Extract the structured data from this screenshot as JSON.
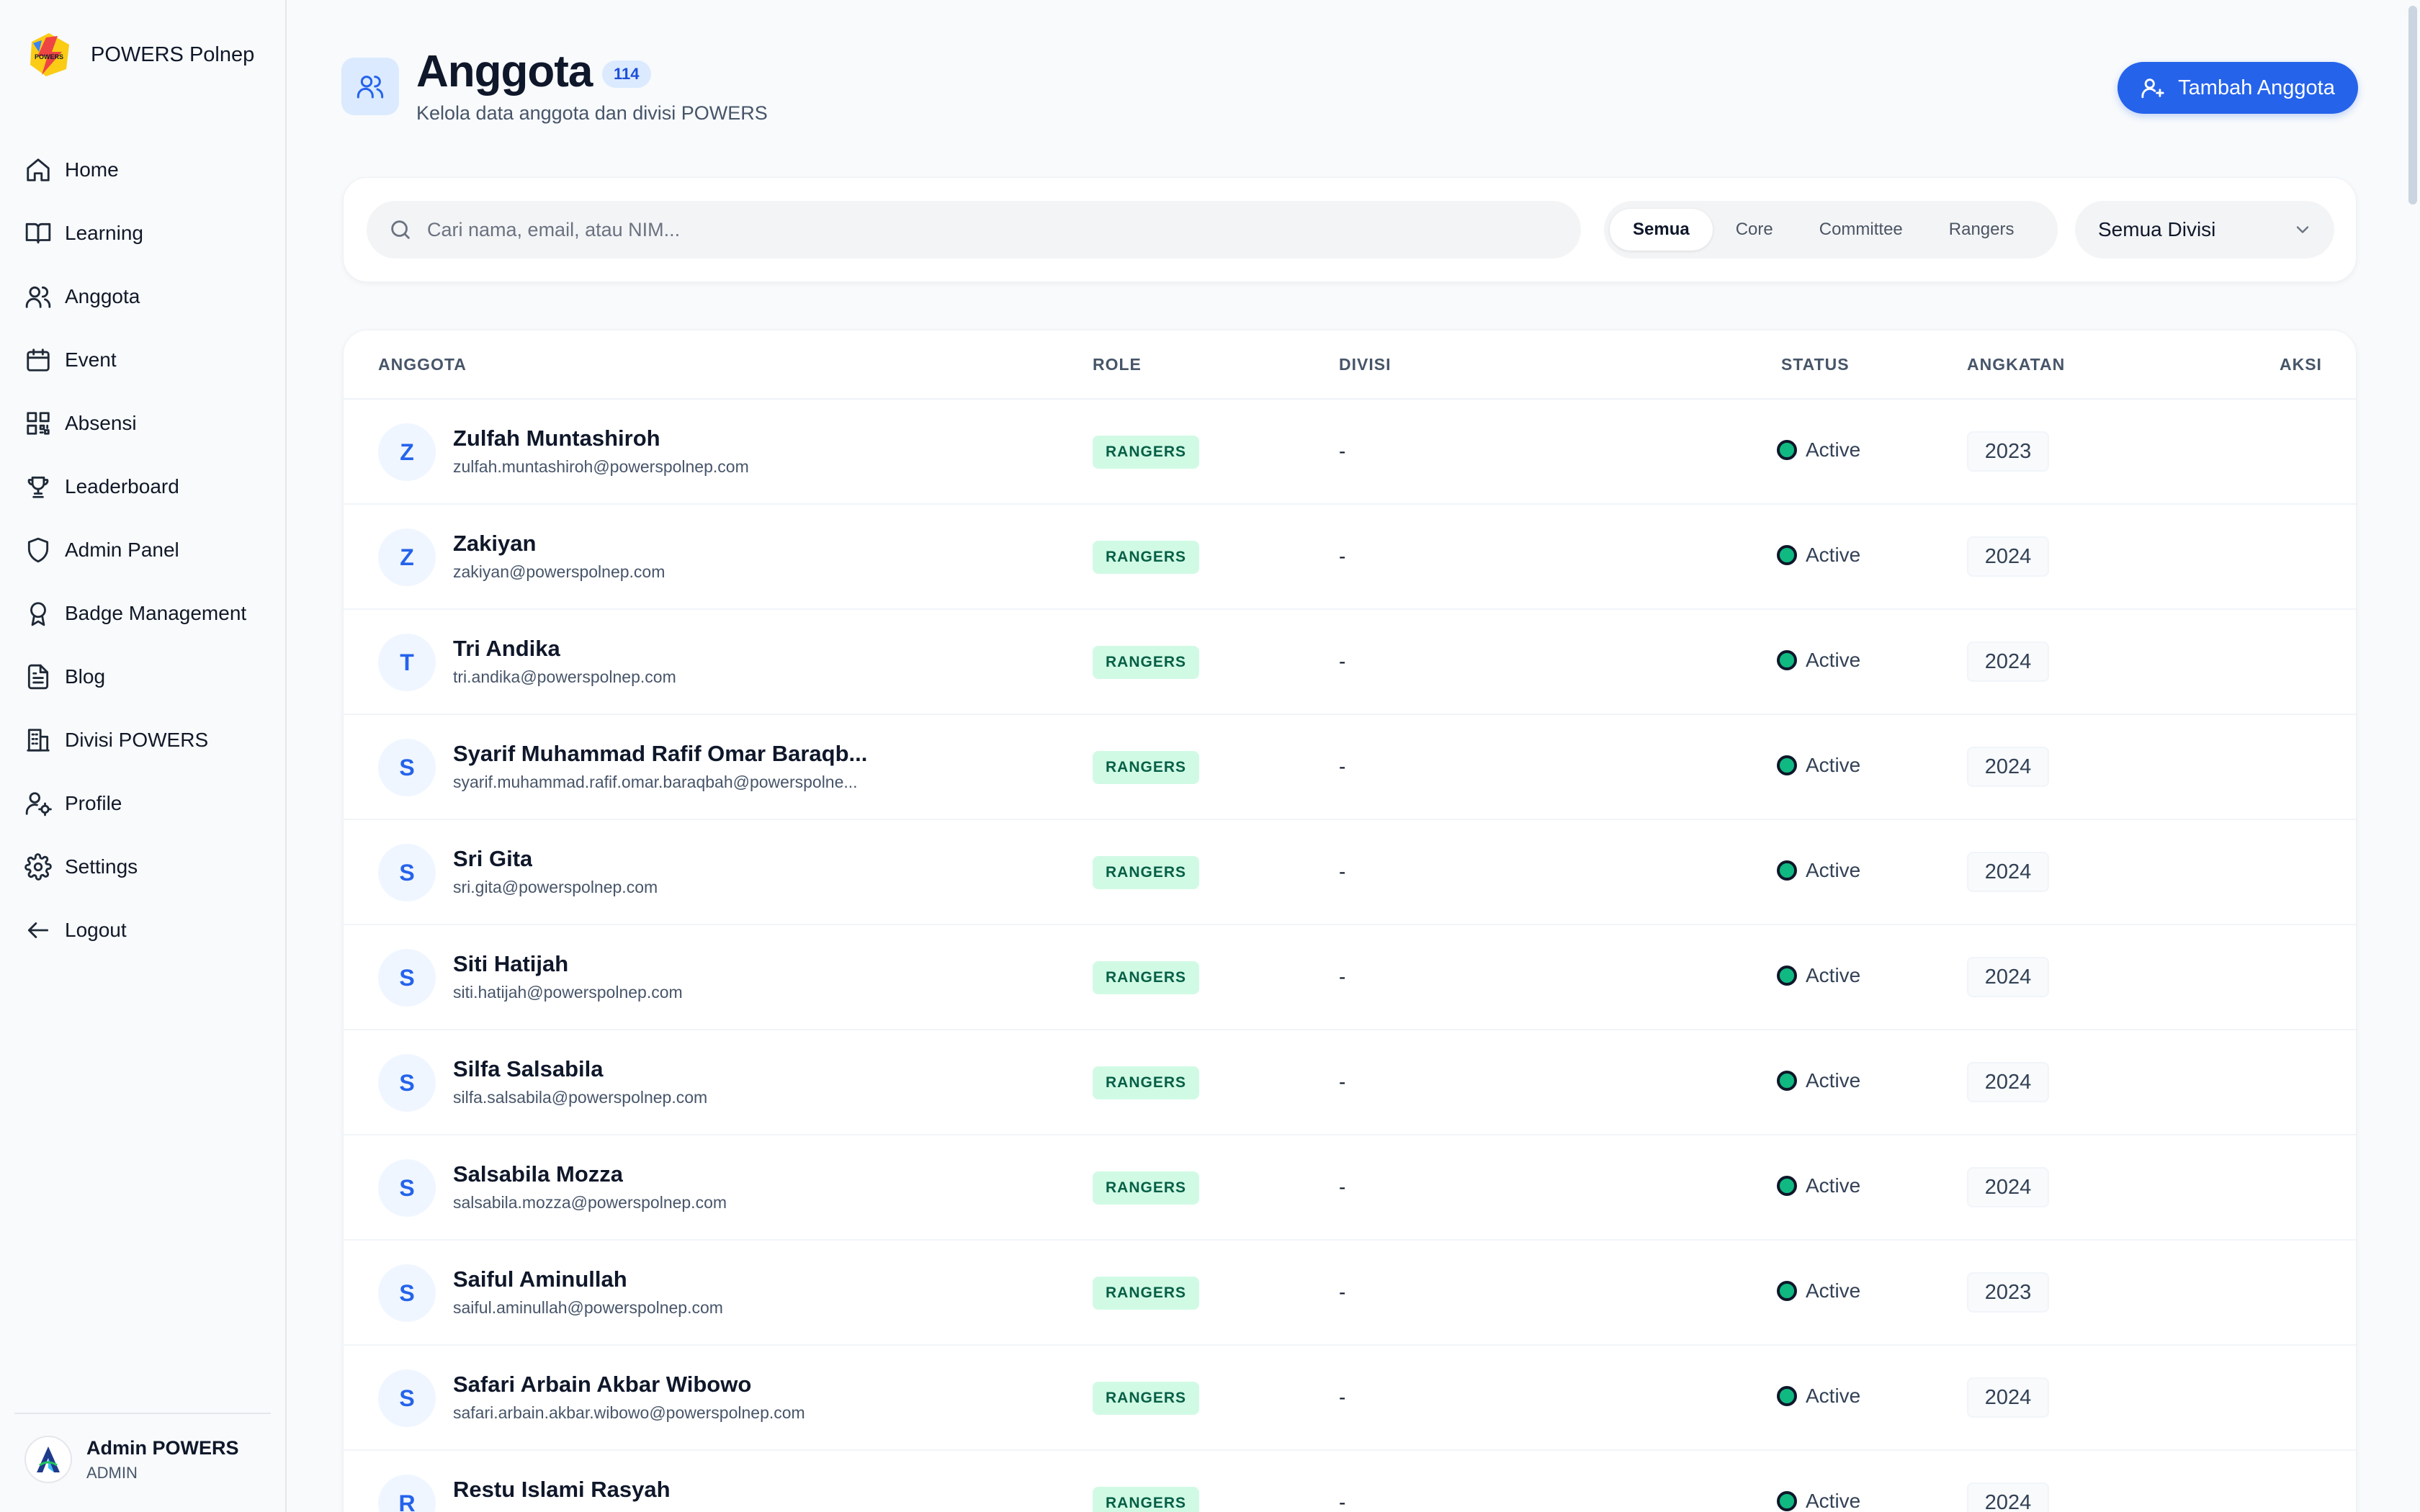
{
  "app": {
    "name": "POWERS Polnep",
    "logo_text": "POWERS"
  },
  "sidebar": {
    "items": [
      {
        "label": "Home",
        "icon": "home-icon"
      },
      {
        "label": "Learning",
        "icon": "book-icon"
      },
      {
        "label": "Anggota",
        "icon": "users-icon"
      },
      {
        "label": "Event",
        "icon": "calendar-icon"
      },
      {
        "label": "Absensi",
        "icon": "qr-code-icon"
      },
      {
        "label": "Leaderboard",
        "icon": "trophy-icon"
      },
      {
        "label": "Admin Panel",
        "icon": "shield-icon"
      },
      {
        "label": "Badge Management",
        "icon": "award-icon"
      },
      {
        "label": "Blog",
        "icon": "file-text-icon"
      },
      {
        "label": "Divisi POWERS",
        "icon": "building-icon"
      },
      {
        "label": "Profile",
        "icon": "user-cog-icon"
      },
      {
        "label": "Settings",
        "icon": "gear-icon"
      },
      {
        "label": "Logout",
        "icon": "arrow-left-icon"
      }
    ],
    "user": {
      "name": "Admin POWERS",
      "role": "ADMIN"
    }
  },
  "header": {
    "title": "Anggota",
    "count": "114",
    "subtitle": "Kelola data anggota dan divisi POWERS",
    "add_button": "Tambah Anggota"
  },
  "filters": {
    "search_placeholder": "Cari nama, email, atau NIM...",
    "segments": [
      "Semua",
      "Core",
      "Committee",
      "Rangers"
    ],
    "active_segment": "Semua",
    "division_select": "Semua Divisi"
  },
  "table": {
    "headers": {
      "member": "ANGGOTA",
      "role": "ROLE",
      "division": "DIVISI",
      "status": "STATUS",
      "batch": "ANGKATAN",
      "actions": "AKSI"
    },
    "rows": [
      {
        "initial": "Z",
        "name": "Zulfah Muntashiroh",
        "email": "zulfah.muntashiroh@powerspolnep.com",
        "role": "RANGERS",
        "division": "-",
        "status": "Active",
        "year": "2023"
      },
      {
        "initial": "Z",
        "name": "Zakiyan",
        "email": "zakiyan@powerspolnep.com",
        "role": "RANGERS",
        "division": "-",
        "status": "Active",
        "year": "2024"
      },
      {
        "initial": "T",
        "name": "Tri Andika",
        "email": "tri.andika@powerspolnep.com",
        "role": "RANGERS",
        "division": "-",
        "status": "Active",
        "year": "2024"
      },
      {
        "initial": "S",
        "name": "Syarif Muhammad Rafif Omar Baraqb...",
        "email": "syarif.muhammad.rafif.omar.baraqbah@powerspolne...",
        "role": "RANGERS",
        "division": "-",
        "status": "Active",
        "year": "2024"
      },
      {
        "initial": "S",
        "name": "Sri Gita",
        "email": "sri.gita@powerspolnep.com",
        "role": "RANGERS",
        "division": "-",
        "status": "Active",
        "year": "2024"
      },
      {
        "initial": "S",
        "name": "Siti Hatijah",
        "email": "siti.hatijah@powerspolnep.com",
        "role": "RANGERS",
        "division": "-",
        "status": "Active",
        "year": "2024"
      },
      {
        "initial": "S",
        "name": "Silfa Salsabila",
        "email": "silfa.salsabila@powerspolnep.com",
        "role": "RANGERS",
        "division": "-",
        "status": "Active",
        "year": "2024"
      },
      {
        "initial": "S",
        "name": "Salsabila Mozza",
        "email": "salsabila.mozza@powerspolnep.com",
        "role": "RANGERS",
        "division": "-",
        "status": "Active",
        "year": "2024"
      },
      {
        "initial": "S",
        "name": "Saiful Aminullah",
        "email": "saiful.aminullah@powerspolnep.com",
        "role": "RANGERS",
        "division": "-",
        "status": "Active",
        "year": "2023"
      },
      {
        "initial": "S",
        "name": "Safari Arbain Akbar Wibowo",
        "email": "safari.arbain.akbar.wibowo@powerspolnep.com",
        "role": "RANGERS",
        "division": "-",
        "status": "Active",
        "year": "2024"
      },
      {
        "initial": "R",
        "name": "Restu Islami Rasyah",
        "email": "",
        "role": "RANGERS",
        "division": "-",
        "status": "Active",
        "year": "2024"
      }
    ]
  },
  "colors": {
    "accent": "#2563eb",
    "role_badge_bg": "#d1fae5",
    "status_active": "#10b981"
  }
}
